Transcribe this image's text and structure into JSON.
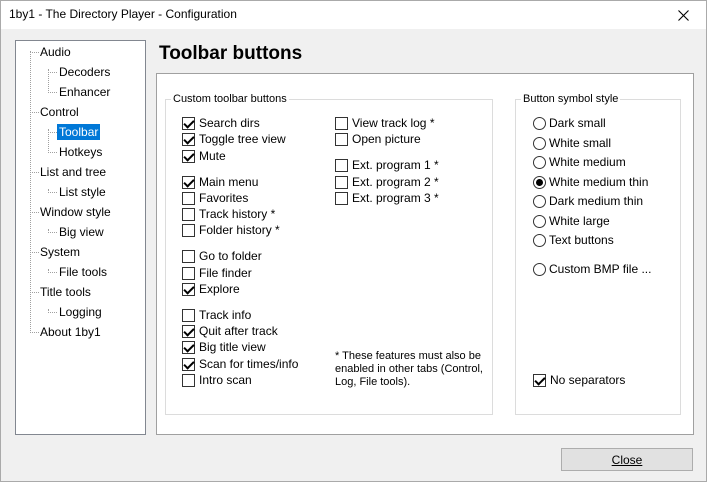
{
  "window": {
    "title": "1by1 - The Directory Player - Configuration"
  },
  "tree": {
    "audio": "Audio",
    "decoders": "Decoders",
    "enhancer": "Enhancer",
    "control": "Control",
    "toolbar": "Toolbar",
    "hotkeys": "Hotkeys",
    "list_and_tree": "List and tree",
    "list_style": "List style",
    "window_style": "Window style",
    "big_view": "Big view",
    "system": "System",
    "file_tools": "File tools",
    "title_tools": "Title tools",
    "logging": "Logging",
    "about": "About 1by1"
  },
  "page": {
    "title": "Toolbar buttons"
  },
  "custom": {
    "label": "Custom toolbar buttons",
    "items": [
      {
        "label": "Search dirs",
        "checked": true
      },
      {
        "label": "Toggle tree view",
        "checked": true
      },
      {
        "label": "Mute",
        "checked": true
      },
      {
        "label": "Main menu",
        "checked": true
      },
      {
        "label": "Favorites",
        "checked": false
      },
      {
        "label": "Track history *",
        "checked": false
      },
      {
        "label": "Folder history *",
        "checked": false
      },
      {
        "label": "Go to folder",
        "checked": false
      },
      {
        "label": "File finder",
        "checked": false
      },
      {
        "label": "Explore",
        "checked": true
      },
      {
        "label": "Track info",
        "checked": false
      },
      {
        "label": "Quit after track",
        "checked": true
      },
      {
        "label": "Big title view",
        "checked": true
      },
      {
        "label": "Scan for times/info",
        "checked": true
      },
      {
        "label": "Intro scan",
        "checked": false
      },
      {
        "label": "View track log *",
        "checked": false
      },
      {
        "label": "Open picture",
        "checked": false
      },
      {
        "label": "Ext. program 1 *",
        "checked": false
      },
      {
        "label": "Ext. program 2 *",
        "checked": false
      },
      {
        "label": "Ext. program 3 *",
        "checked": false
      }
    ],
    "note": "* These features must also be enabled in other tabs (Control, Log, File tools)."
  },
  "symbol": {
    "label": "Button symbol style",
    "options": [
      {
        "label": "Dark small",
        "selected": false
      },
      {
        "label": "White small",
        "selected": false
      },
      {
        "label": "White medium",
        "selected": false
      },
      {
        "label": "White medium thin",
        "selected": true
      },
      {
        "label": "Dark medium thin",
        "selected": false
      },
      {
        "label": "White large",
        "selected": false
      },
      {
        "label": "Text buttons",
        "selected": false
      },
      {
        "label": "Custom BMP file ...",
        "selected": false
      }
    ],
    "no_separators": {
      "label": "No separators",
      "checked": true
    }
  },
  "buttons": {
    "close": "Close"
  },
  "icons": {
    "close": "close-icon"
  }
}
